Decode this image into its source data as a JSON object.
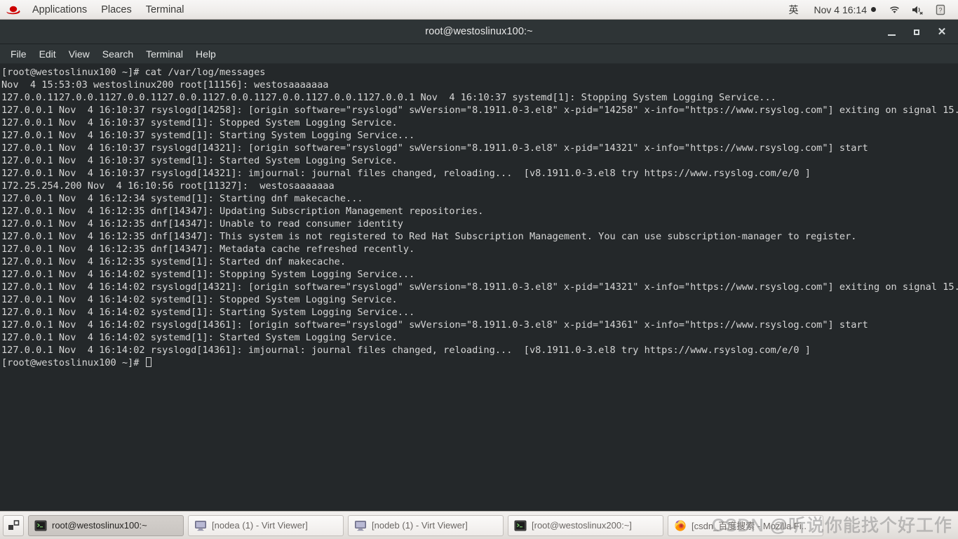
{
  "top_panel": {
    "logo_icon": "redhat-logo-icon",
    "menus": [
      "Applications",
      "Places",
      "Terminal"
    ],
    "ime_indicator": "英",
    "clock": "Nov 4  16:14",
    "recording_dot": "●",
    "tray_icons": [
      "wifi-icon",
      "volume-muted-icon",
      "battery-unknown-icon"
    ]
  },
  "window": {
    "title": "root@westoslinux100:~",
    "controls": {
      "minimize": "minimize-icon",
      "maximize": "maximize-icon",
      "close": "close-icon"
    },
    "menubar": [
      "File",
      "Edit",
      "View",
      "Search",
      "Terminal",
      "Help"
    ]
  },
  "terminal": {
    "prompt": "[root@westoslinux100 ~]#",
    "command": "cat /var/log/messages",
    "lines": [
      "[root@westoslinux100 ~]# cat /var/log/messages",
      "Nov  4 15:53:03 westoslinux200 root[11156]: westosaaaaaaa",
      "127.0.0.1127.0.0.1127.0.0.1127.0.0.1127.0.0.1127.0.0.1127.0.0.1127.0.0.1 Nov  4 16:10:37 systemd[1]: Stopping System Logging Service...",
      "127.0.0.1 Nov  4 16:10:37 rsyslogd[14258]: [origin software=\"rsyslogd\" swVersion=\"8.1911.0-3.el8\" x-pid=\"14258\" x-info=\"https://www.rsyslog.com\"] exiting on signal 15.",
      "127.0.0.1 Nov  4 16:10:37 systemd[1]: Stopped System Logging Service.",
      "127.0.0.1 Nov  4 16:10:37 systemd[1]: Starting System Logging Service...",
      "127.0.0.1 Nov  4 16:10:37 rsyslogd[14321]: [origin software=\"rsyslogd\" swVersion=\"8.1911.0-3.el8\" x-pid=\"14321\" x-info=\"https://www.rsyslog.com\"] start",
      "127.0.0.1 Nov  4 16:10:37 systemd[1]: Started System Logging Service.",
      "127.0.0.1 Nov  4 16:10:37 rsyslogd[14321]: imjournal: journal files changed, reloading...  [v8.1911.0-3.el8 try https://www.rsyslog.com/e/0 ]",
      "172.25.254.200 Nov  4 16:10:56 root[11327]:  westosaaaaaaa",
      "127.0.0.1 Nov  4 16:12:34 systemd[1]: Starting dnf makecache...",
      "127.0.0.1 Nov  4 16:12:35 dnf[14347]: Updating Subscription Management repositories.",
      "127.0.0.1 Nov  4 16:12:35 dnf[14347]: Unable to read consumer identity",
      "127.0.0.1 Nov  4 16:12:35 dnf[14347]: This system is not registered to Red Hat Subscription Management. You can use subscription-manager to register.",
      "127.0.0.1 Nov  4 16:12:35 dnf[14347]: Metadata cache refreshed recently.",
      "127.0.0.1 Nov  4 16:12:35 systemd[1]: Started dnf makecache.",
      "127.0.0.1 Nov  4 16:14:02 systemd[1]: Stopping System Logging Service...",
      "127.0.0.1 Nov  4 16:14:02 rsyslogd[14321]: [origin software=\"rsyslogd\" swVersion=\"8.1911.0-3.el8\" x-pid=\"14321\" x-info=\"https://www.rsyslog.com\"] exiting on signal 15.",
      "127.0.0.1 Nov  4 16:14:02 systemd[1]: Stopped System Logging Service.",
      "127.0.0.1 Nov  4 16:14:02 systemd[1]: Starting System Logging Service...",
      "127.0.0.1 Nov  4 16:14:02 rsyslogd[14361]: [origin software=\"rsyslogd\" swVersion=\"8.1911.0-3.el8\" x-pid=\"14361\" x-info=\"https://www.rsyslog.com\"] start",
      "127.0.0.1 Nov  4 16:14:02 systemd[1]: Started System Logging Service.",
      "127.0.0.1 Nov  4 16:14:02 rsyslogd[14361]: imjournal: journal files changed, reloading...  [v8.1911.0-3.el8 try https://www.rsyslog.com/e/0 ]",
      "[root@westoslinux100 ~]# "
    ]
  },
  "taskbar": {
    "show_desktop_icon": "show-desktop-icon",
    "tasks": [
      {
        "label": "root@westoslinux100:~",
        "icon": "terminal-icon",
        "active": true
      },
      {
        "label": "[nodea (1) - Virt Viewer]",
        "icon": "monitor-icon",
        "active": false
      },
      {
        "label": "[nodeb (1) - Virt Viewer]",
        "icon": "monitor-icon",
        "active": false
      },
      {
        "label": "[root@westoslinux200:~]",
        "icon": "terminal-icon",
        "active": false
      },
      {
        "label": "[csdn_百度搜索 - Mozilla Fi..",
        "icon": "firefox-icon",
        "active": false
      }
    ]
  },
  "watermark": {
    "text": "CSDN @听说你能找个好工作"
  },
  "colors": {
    "terminal_bg": "#24282a",
    "terminal_fg": "#d6d6d6",
    "titlebar_bg": "#2e3436",
    "panel_bg": "#efedeb",
    "accent_red": "#cc0000"
  }
}
